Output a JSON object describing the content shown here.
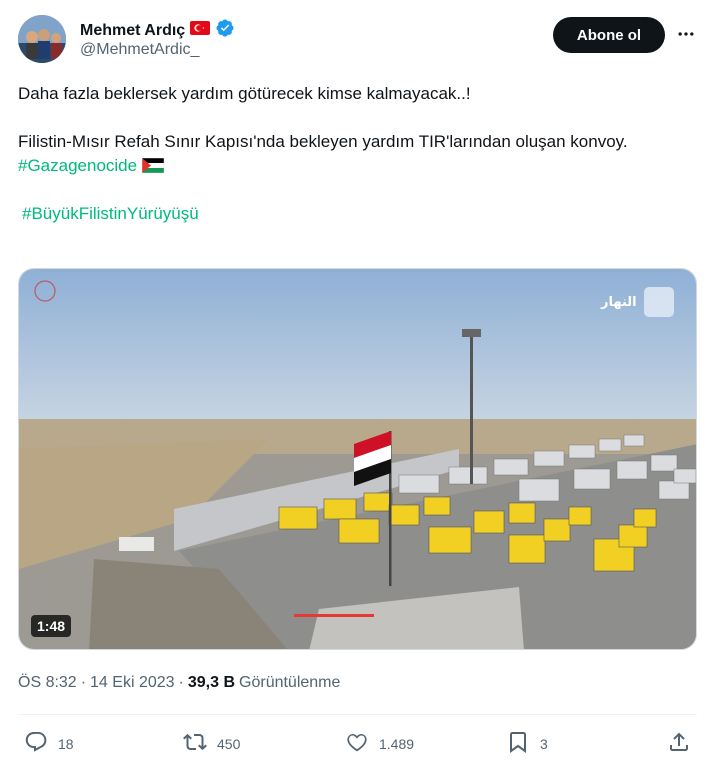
{
  "author": {
    "display_name": "Mehmet Ardıç",
    "handle": "@MehmetArdic_",
    "flag": "🇹🇷"
  },
  "follow_label": "Abone ol",
  "tweet": {
    "line1": "Daha fazla beklersek yardım götürecek kimse kalmayacak..!",
    "line2_text": "Filistin-Mısır Refah Sınır Kapısı'nda bekleyen yardım TIR'larından oluşan konvoy. ",
    "hashtag1": "#Gazagenocide",
    "flag_emoji": "🇵🇸",
    "hashtag2": "#BüyükFilistinYürüyüşü"
  },
  "media": {
    "duration": "1:48",
    "channel_watermark": "النهار"
  },
  "meta": {
    "time": "ÖS 8:32",
    "separator": "·",
    "date": "14 Eki 2023",
    "views_count": "39,3 B",
    "views_label": "Görüntülenme"
  },
  "actions": {
    "replies": "18",
    "reposts": "450",
    "likes": "1.489",
    "bookmarks": "3"
  },
  "colors": {
    "accent": "#00ba7c",
    "verified": "#1d9bf0",
    "text": "#0f1419",
    "muted": "#536471"
  }
}
